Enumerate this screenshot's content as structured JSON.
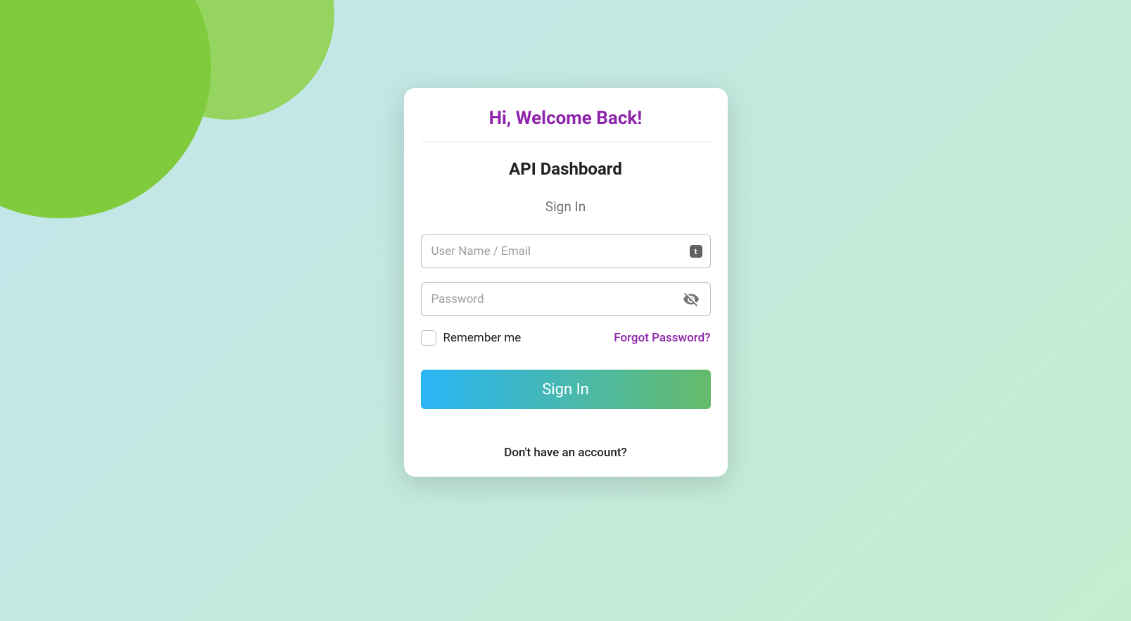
{
  "header": {
    "welcome": "Hi, Welcome Back!",
    "app_title": "API Dashboard",
    "sign_in_label": "Sign In"
  },
  "form": {
    "username": {
      "placeholder": "User Name / Email",
      "value": ""
    },
    "password": {
      "placeholder": "Password",
      "value": ""
    },
    "remember_label": "Remember me",
    "forgot_label": "Forgot Password?",
    "submit_label": "Sign In"
  },
  "footer": {
    "no_account_text": "Don't have an account?"
  },
  "icons": {
    "autofill_badge": "t",
    "visibility_off": "visibility-off-icon"
  },
  "colors": {
    "accent_purple": "#8e24aa",
    "gradient_start": "#29b6f6",
    "gradient_end": "#66bb6a",
    "bg_circle_main": "#7fcb3c",
    "bg_circle_light": "#96d460"
  }
}
